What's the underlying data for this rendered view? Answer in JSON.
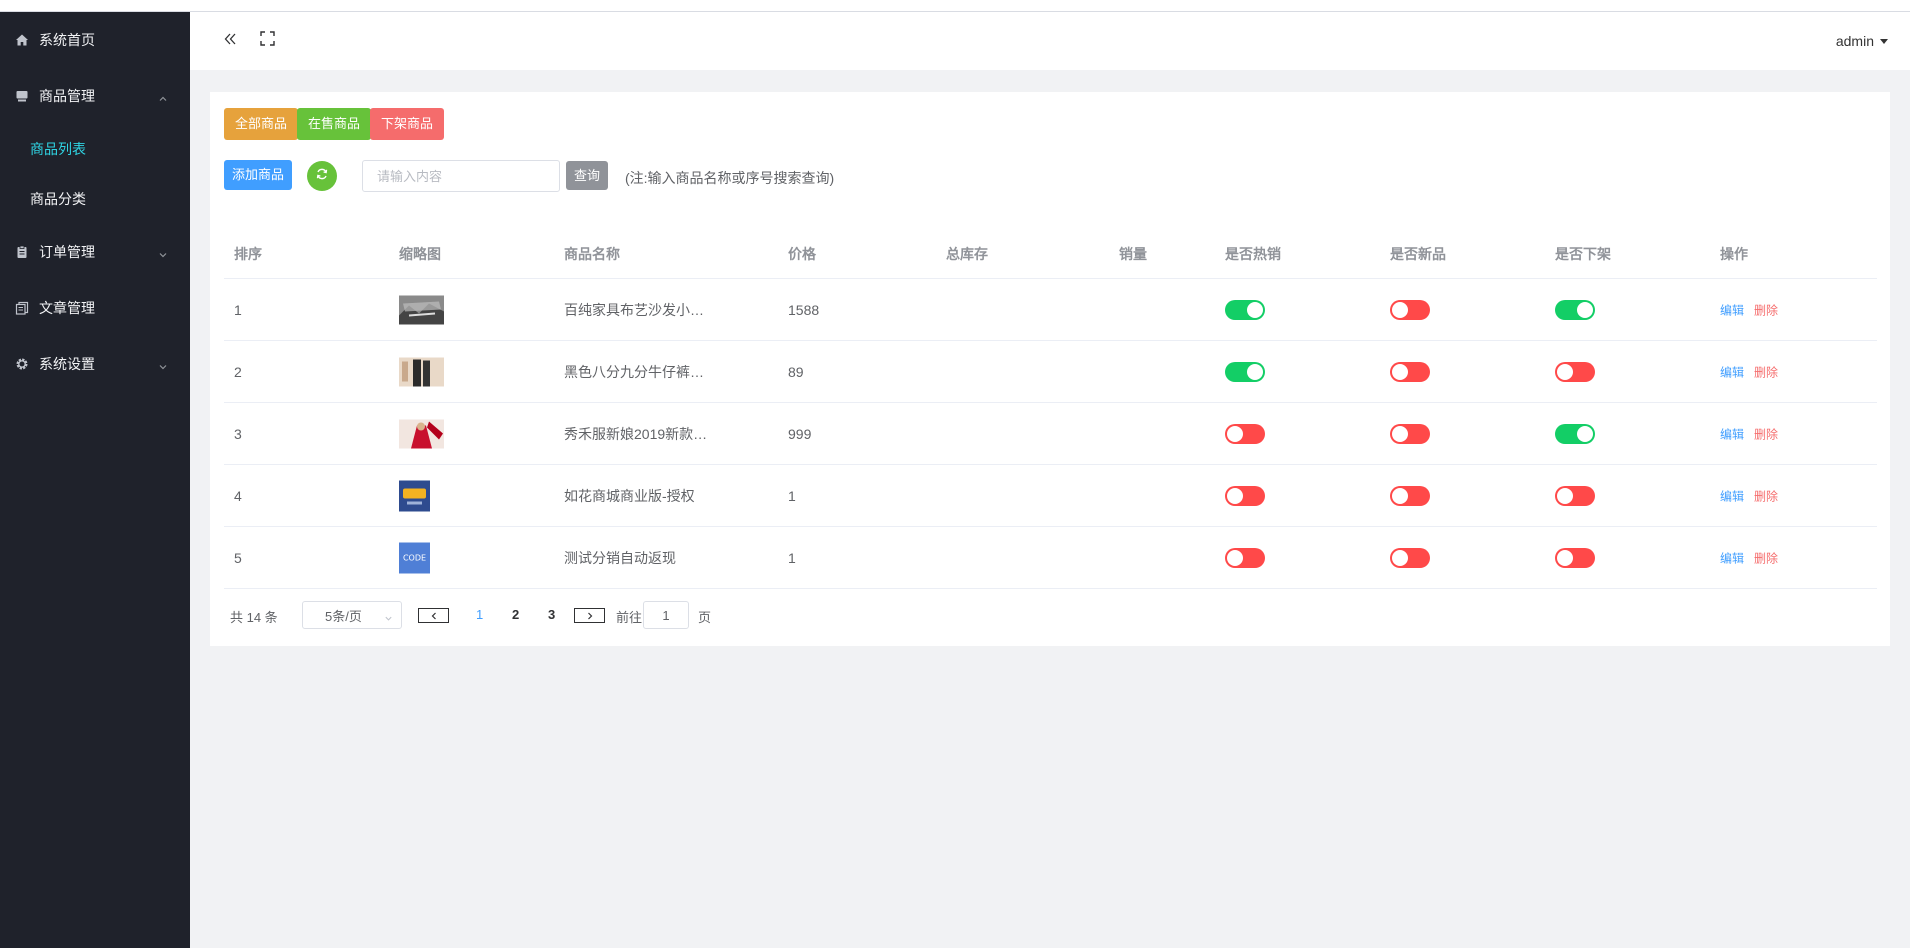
{
  "sidebar": {
    "items": [
      {
        "label": "系统首页",
        "icon": "home-icon"
      },
      {
        "label": "商品管理",
        "icon": "product-icon",
        "expanded": true,
        "children": [
          {
            "label": "商品列表",
            "active": true
          },
          {
            "label": "商品分类",
            "active": false
          }
        ]
      },
      {
        "label": "订单管理",
        "icon": "order-icon"
      },
      {
        "label": "文章管理",
        "icon": "article-icon"
      },
      {
        "label": "系统设置",
        "icon": "gear-icon"
      }
    ]
  },
  "header": {
    "collapse_icon": "double-chevron-left-icon",
    "fullscreen_icon": "fullscreen-icon",
    "user": "admin"
  },
  "filters": {
    "all": "全部商品",
    "on_sale": "在售商品",
    "off_shelf": "下架商品"
  },
  "toolbar": {
    "add_label": "添加商品",
    "search_placeholder": "请输入内容",
    "search_value": "",
    "query_label": "查询",
    "note": "(注:输入商品名称或序号搜索查询)"
  },
  "table": {
    "columns": [
      "排序",
      "缩略图",
      "商品名称",
      "价格",
      "总库存",
      "销量",
      "是否热销",
      "是否新品",
      "是否下架",
      "操作"
    ],
    "rows": [
      {
        "index": "1",
        "name": "百纯家具布艺沙发小…",
        "price": "1588",
        "stock": "",
        "sales": "",
        "hot": true,
        "new": false,
        "off_shelf": true
      },
      {
        "index": "2",
        "name": "黑色八分九分牛仔裤…",
        "price": "89",
        "stock": "",
        "sales": "",
        "hot": true,
        "new": false,
        "off_shelf": false
      },
      {
        "index": "3",
        "name": "秀禾服新娘2019新款…",
        "price": "999",
        "stock": "",
        "sales": "",
        "hot": false,
        "new": false,
        "off_shelf": true
      },
      {
        "index": "4",
        "name": "如花商城商业版-授权",
        "price": "1",
        "stock": "",
        "sales": "",
        "hot": false,
        "new": false,
        "off_shelf": false
      },
      {
        "index": "5",
        "name": "测试分销自动返现",
        "price": "1",
        "stock": "",
        "sales": "",
        "hot": false,
        "new": false,
        "off_shelf": false
      }
    ],
    "actions": {
      "edit": "编辑",
      "delete": "删除"
    },
    "thumb_5_text": "CODE"
  },
  "pagination": {
    "total": "共 14 条",
    "page_size": "5条/页",
    "pages": [
      "1",
      "2",
      "3"
    ],
    "current": "1",
    "goto_prefix": "前往",
    "goto_value": "1",
    "goto_suffix": "页"
  },
  "colors": {
    "sidebar_bg": "#1f222b",
    "active_menu": "#2fd4e3",
    "filter_all": "#e6a23c",
    "filter_on_sale": "#67c23a",
    "filter_off_shelf": "#f56c6c",
    "primary": "#409eff",
    "switch_on": "#13ce66",
    "switch_off": "#ff4949"
  }
}
